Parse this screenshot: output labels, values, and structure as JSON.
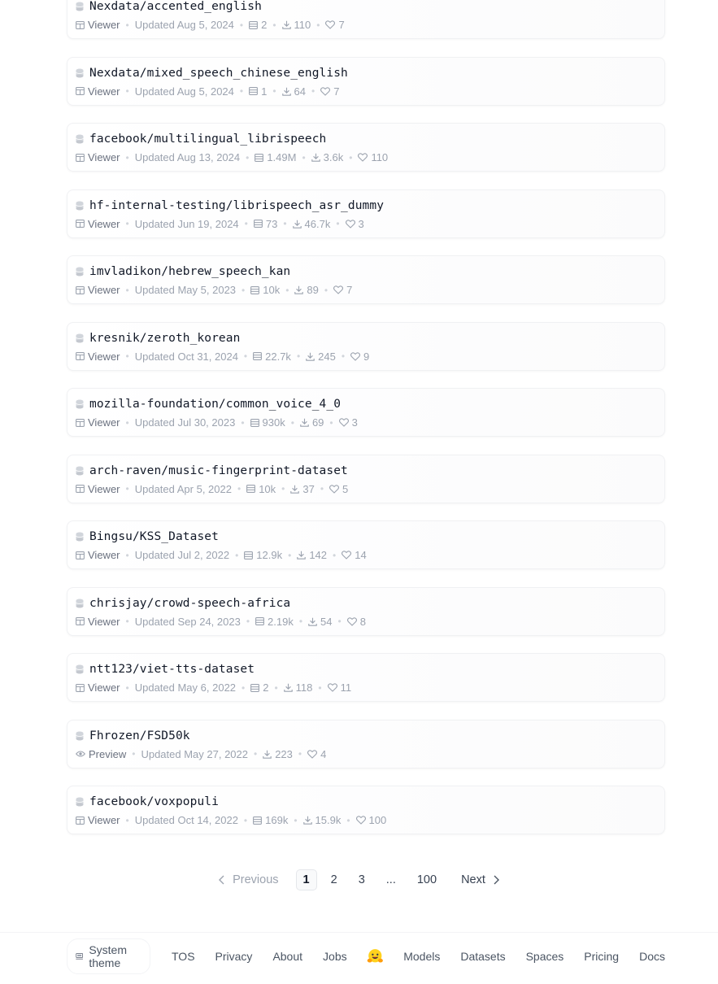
{
  "datasets": [
    {
      "name": "Nexdata/accented_english",
      "mode": "Viewer",
      "updated": "Updated Aug 5, 2024",
      "rows": "2",
      "downloads": "110",
      "likes": "7"
    },
    {
      "name": "Nexdata/mixed_speech_chinese_english",
      "mode": "Viewer",
      "updated": "Updated Aug 5, 2024",
      "rows": "1",
      "downloads": "64",
      "likes": "7"
    },
    {
      "name": "facebook/multilingual_librispeech",
      "mode": "Viewer",
      "updated": "Updated Aug 13, 2024",
      "rows": "1.49M",
      "downloads": "3.6k",
      "likes": "110"
    },
    {
      "name": "hf-internal-testing/librispeech_asr_dummy",
      "mode": "Viewer",
      "updated": "Updated Jun 19, 2024",
      "rows": "73",
      "downloads": "46.7k",
      "likes": "3"
    },
    {
      "name": "imvladikon/hebrew_speech_kan",
      "mode": "Viewer",
      "updated": "Updated May 5, 2023",
      "rows": "10k",
      "downloads": "89",
      "likes": "7"
    },
    {
      "name": "kresnik/zeroth_korean",
      "mode": "Viewer",
      "updated": "Updated Oct 31, 2024",
      "rows": "22.7k",
      "downloads": "245",
      "likes": "9"
    },
    {
      "name": "mozilla-foundation/common_voice_4_0",
      "mode": "Viewer",
      "updated": "Updated Jul 30, 2023",
      "rows": "930k",
      "downloads": "69",
      "likes": "3"
    },
    {
      "name": "arch-raven/music-fingerprint-dataset",
      "mode": "Viewer",
      "updated": "Updated Apr 5, 2022",
      "rows": "10k",
      "downloads": "37",
      "likes": "5"
    },
    {
      "name": "Bingsu/KSS_Dataset",
      "mode": "Viewer",
      "updated": "Updated Jul 2, 2022",
      "rows": "12.9k",
      "downloads": "142",
      "likes": "14"
    },
    {
      "name": "chrisjay/crowd-speech-africa",
      "mode": "Viewer",
      "updated": "Updated Sep 24, 2023",
      "rows": "2.19k",
      "downloads": "54",
      "likes": "8"
    },
    {
      "name": "ntt123/viet-tts-dataset",
      "mode": "Viewer",
      "updated": "Updated May 6, 2022",
      "rows": "2",
      "downloads": "118",
      "likes": "11"
    },
    {
      "name": "Fhrozen/FSD50k",
      "mode": "Preview",
      "updated": "Updated May 27, 2022",
      "rows": null,
      "downloads": "223",
      "likes": "4"
    },
    {
      "name": "facebook/voxpopuli",
      "mode": "Viewer",
      "updated": "Updated Oct 14, 2022",
      "rows": "169k",
      "downloads": "15.9k",
      "likes": "100"
    }
  ],
  "pagination": {
    "previous": "Previous",
    "pages": [
      "1",
      "2",
      "3",
      "...",
      "100"
    ],
    "current": "1",
    "next": "Next"
  },
  "footer": {
    "theme": "System theme",
    "links": [
      "TOS",
      "Privacy",
      "About",
      "Jobs"
    ],
    "links2": [
      "Models",
      "Datasets",
      "Spaces",
      "Pricing",
      "Docs"
    ]
  },
  "icons": {
    "dataset": "database-icon",
    "viewer": "table-icon",
    "preview": "eye-icon",
    "rows": "rows-icon",
    "downloads": "download-icon",
    "likes": "heart-icon",
    "logo": "hugging-face-logo"
  },
  "colors": {
    "text": "#111827",
    "meta": "#9ca3af",
    "border": "#f0f1f3"
  }
}
